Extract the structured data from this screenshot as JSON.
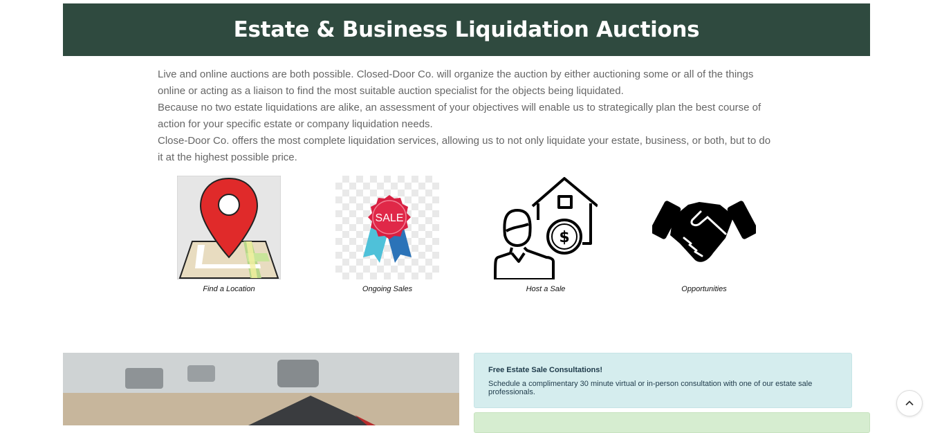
{
  "hero": {
    "title": "Estate & Business Liquidation Auctions"
  },
  "intro": {
    "p1": "Live and online auctions are both possible. Closed-Door Co. will organize the auction by either auctioning some or all of the things online or acting as a liaison to find the most suitable auction specialist for the objects being liquidated.",
    "p2": "Because no two estate liquidations are alike, an assessment of your objectives will enable us to strategically plan the best course of action for your specific estate or company liquidation needs.",
    "p3": "Close-Door Co. offers the most complete liquidation services, allowing us to not only liquidate your estate, business, or both, but to do it at the highest possible price."
  },
  "cards": [
    {
      "caption": "Find a Location",
      "icon": "map-pin-icon"
    },
    {
      "caption": "Ongoing Sales",
      "icon": "sale-badge-icon",
      "badge_text": "SALE"
    },
    {
      "caption": "Host a Sale",
      "icon": "host-house-dollar-icon"
    },
    {
      "caption": "Opportunities",
      "icon": "handshake-icon"
    }
  ],
  "consult": {
    "title": "Free Estate Sale Consultations!",
    "text": "Schedule a complimentary 30 minute virtual or in-person consultation with one of our estate sale professionals."
  },
  "colors": {
    "hero_bg": "#2f4a3f",
    "info_bg": "#d5edee",
    "green_bg": "#d6edd0"
  }
}
